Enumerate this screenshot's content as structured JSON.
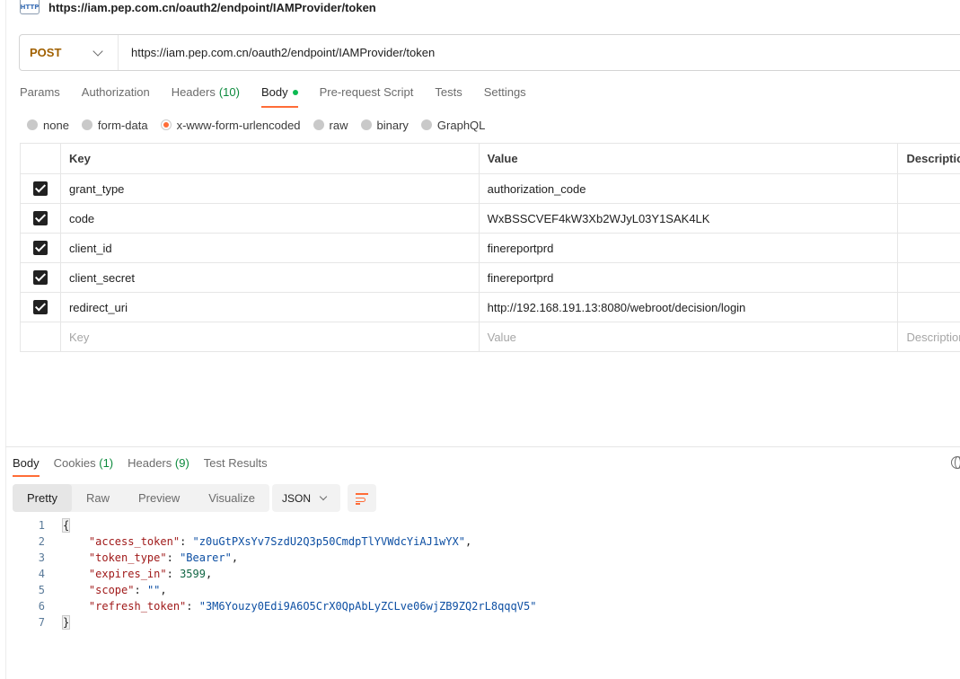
{
  "page": {
    "title": "https://iam.pep.com.cn/oauth2/endpoint/IAMProvider/token",
    "icon": "http-icon"
  },
  "request": {
    "method": "POST",
    "url": "https://iam.pep.com.cn/oauth2/endpoint/IAMProvider/token"
  },
  "req_tabs": [
    {
      "label": "Params"
    },
    {
      "label": "Authorization"
    },
    {
      "label": "Headers",
      "count": "(10)"
    },
    {
      "label": "Body",
      "active": true
    },
    {
      "label": "Pre-request Script"
    },
    {
      "label": "Tests"
    },
    {
      "label": "Settings"
    }
  ],
  "body_types": [
    {
      "label": "none"
    },
    {
      "label": "form-data"
    },
    {
      "label": "x-www-form-urlencoded",
      "selected": true
    },
    {
      "label": "raw"
    },
    {
      "label": "binary"
    },
    {
      "label": "GraphQL"
    }
  ],
  "table": {
    "headers": {
      "key": "Key",
      "value": "Value",
      "description": "Description"
    },
    "rows": [
      {
        "key": "grant_type",
        "value": "authorization_code"
      },
      {
        "key": "code",
        "value": "WxBSSCVEF4kW3Xb2WJyL03Y1SAK4LK"
      },
      {
        "key": "client_id",
        "value": "finereportprd"
      },
      {
        "key": "client_secret",
        "value": "finereportprd"
      },
      {
        "key": "redirect_uri",
        "value": "http://192.168.191.13:8080/webroot/decision/login"
      }
    ],
    "placeholder": {
      "key": "Key",
      "value": "Value",
      "description": "Description"
    }
  },
  "resp_tabs": [
    {
      "label": "Body",
      "active": true
    },
    {
      "label": "Cookies",
      "count": "(1)"
    },
    {
      "label": "Headers",
      "count": "(9)"
    },
    {
      "label": "Test Results"
    }
  ],
  "view_modes": [
    {
      "label": "Pretty",
      "active": true
    },
    {
      "label": "Raw"
    },
    {
      "label": "Preview"
    },
    {
      "label": "Visualize"
    }
  ],
  "format": "JSON",
  "response": {
    "line_numbers": [
      "1",
      "2",
      "3",
      "4",
      "5",
      "6",
      "7"
    ],
    "open_brace": "{",
    "close_brace": "}",
    "fields": [
      {
        "key": "\"access_token\"",
        "value": "\"z0uGtPXsYv7SzdU2Q3p50CmdpTlYVWdcYiAJ1wYX\"",
        "type": "str",
        "comma": ","
      },
      {
        "key": "\"token_type\"",
        "value": "\"Bearer\"",
        "type": "str",
        "comma": ","
      },
      {
        "key": "\"expires_in\"",
        "value": "3599",
        "type": "num",
        "comma": ","
      },
      {
        "key": "\"scope\"",
        "value": "\"\"",
        "type": "str",
        "comma": ","
      },
      {
        "key": "\"refresh_token\"",
        "value": "\"3M6Youzy0Edi9A6O5CrX0QpAbLyZCLve06wjZB9ZQ2rL8qqqV5\"",
        "type": "str",
        "comma": ""
      }
    ]
  },
  "colors": {
    "accent": "#ff6c37",
    "method": "#a06000",
    "count": "#0c8a3d"
  }
}
